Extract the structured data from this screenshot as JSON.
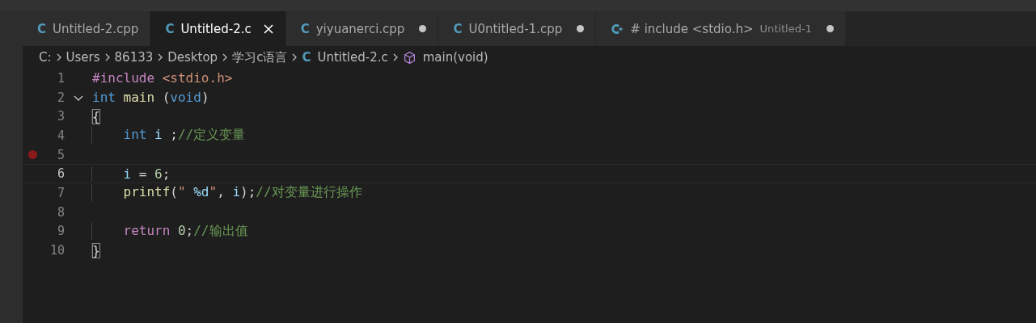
{
  "tabs": [
    {
      "kind": "c",
      "icon_text": "C",
      "label": "Untitled-2.cpp",
      "selected": false,
      "dirty": false
    },
    {
      "kind": "c",
      "icon_text": "C",
      "label": "Untitled-2.c",
      "selected": true,
      "dirty": false
    },
    {
      "kind": "c",
      "icon_text": "C",
      "label": "yiyuanerci.cpp",
      "selected": false,
      "dirty": true
    },
    {
      "kind": "c",
      "icon_text": "C",
      "label": "U0ntitled-1.cpp",
      "selected": false,
      "dirty": true
    },
    {
      "kind": "cpp",
      "label": "# include <stdio.h>",
      "description": "Untitled-1",
      "selected": false,
      "dirty": true
    }
  ],
  "breadcrumb": [
    {
      "kind": "folder",
      "label": "C:"
    },
    {
      "kind": "folder",
      "label": "Users"
    },
    {
      "kind": "folder",
      "label": "86133"
    },
    {
      "kind": "folder",
      "label": "Desktop"
    },
    {
      "kind": "folder",
      "label": "学习c语言"
    },
    {
      "kind": "file",
      "icon_text": "C",
      "label": "Untitled-2.c"
    },
    {
      "kind": "symbol",
      "label": "main(void)"
    }
  ],
  "lines": [
    {
      "number": "1",
      "tokens": [
        {
          "kind": "directive",
          "text": "#include"
        },
        {
          "kind": "string",
          "text": " <stdio.h>"
        }
      ]
    },
    {
      "number": "2",
      "foldable": true,
      "tokens": [
        {
          "kind": "keyword",
          "text": "int"
        },
        {
          "kind": "function",
          "text": " main"
        },
        {
          "kind": "plain",
          "text": " ("
        },
        {
          "kind": "keyword",
          "text": "void"
        },
        {
          "kind": "plain",
          "text": ")"
        }
      ]
    },
    {
      "number": "3",
      "tokens": [
        {
          "kind": "brace",
          "text": "{"
        }
      ]
    },
    {
      "number": "4",
      "tokens": [
        {
          "kind": "keyword",
          "text": "    int"
        },
        {
          "kind": "variable",
          "text": " i"
        },
        {
          "kind": "plain",
          "text": " ;"
        },
        {
          "kind": "comment",
          "text": "//定义变量"
        }
      ]
    },
    {
      "number": "5",
      "breakpoint": true
    },
    {
      "number": "6",
      "current": true,
      "tokens": [
        {
          "kind": "variable",
          "text": "    i"
        },
        {
          "kind": "plain",
          "text": " = "
        },
        {
          "kind": "number",
          "text": "6"
        },
        {
          "kind": "plain",
          "text": ";"
        }
      ]
    },
    {
      "number": "7",
      "tokens": [
        {
          "kind": "function",
          "text": "    printf"
        },
        {
          "kind": "plain",
          "text": "("
        },
        {
          "kind": "string",
          "text": "\" "
        },
        {
          "kind": "variable",
          "text": "%d"
        },
        {
          "kind": "string",
          "text": "\""
        },
        {
          "kind": "plain",
          "text": ", "
        },
        {
          "kind": "variable",
          "text": "i"
        },
        {
          "kind": "plain",
          "text": ");"
        },
        {
          "kind": "comment",
          "text": "//对变量进行操作"
        }
      ]
    },
    {
      "number": "8"
    },
    {
      "number": "9",
      "tokens": [
        {
          "kind": "directive",
          "text": "    return"
        },
        {
          "kind": "number",
          "text": " 0"
        },
        {
          "kind": "plain",
          "text": ";"
        },
        {
          "kind": "comment",
          "text": "//输出值"
        }
      ]
    },
    {
      "number": "10",
      "tokens": [
        {
          "kind": "brace",
          "text": "}"
        }
      ]
    }
  ]
}
